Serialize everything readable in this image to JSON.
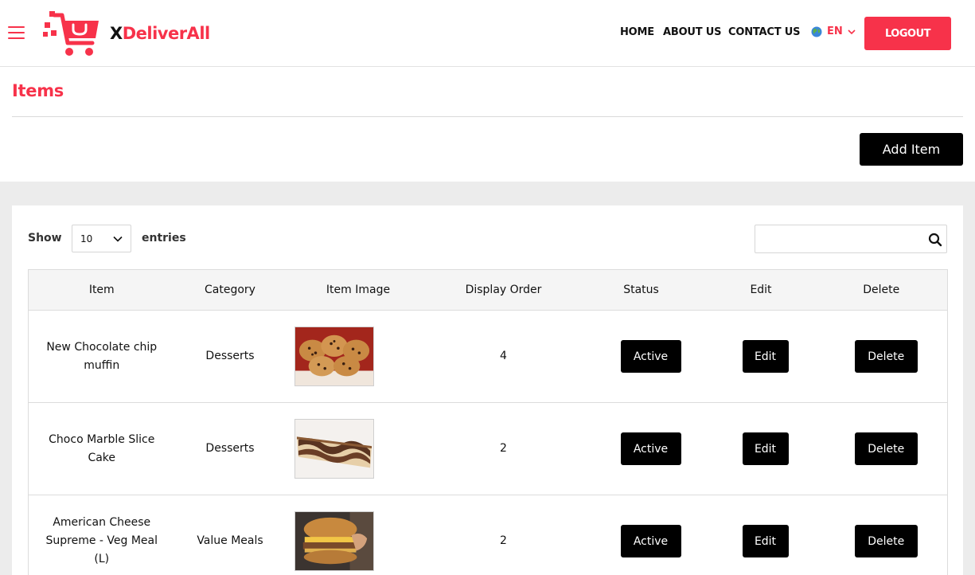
{
  "header": {
    "brand_x": "X",
    "brand_rest": "DeliverAll",
    "nav": {
      "home": "HOME",
      "about": "ABOUT US",
      "contact": "CONTACT US"
    },
    "language": "EN",
    "logout_label": "LOGOUT"
  },
  "page": {
    "title": "Items",
    "add_item_label": "Add Item"
  },
  "table_controls": {
    "show_label": "Show",
    "entries_value": "10",
    "entries_label": "entries",
    "search_value": ""
  },
  "table": {
    "columns": [
      "Item",
      "Category",
      "Item Image",
      "Display Order",
      "Status",
      "Edit",
      "Delete"
    ],
    "rows": [
      {
        "item": "New Chocolate chip muffin",
        "category": "Desserts",
        "image": "muffins-photo",
        "display_order": "4",
        "status": "Active",
        "edit": "Edit",
        "delete": "Delete"
      },
      {
        "item": "Choco Marble Slice Cake",
        "category": "Desserts",
        "image": "marble-cake-photo",
        "display_order": "2",
        "status": "Active",
        "edit": "Edit",
        "delete": "Delete"
      },
      {
        "item": "American Cheese Supreme - Veg Meal (L)",
        "category": "Value Meals",
        "image": "burger-photo",
        "display_order": "2",
        "status": "Active",
        "edit": "Edit",
        "delete": "Delete"
      }
    ]
  },
  "colors": {
    "accent": "#f7324a",
    "button_dark": "#000000",
    "page_gray": "#ececec"
  }
}
